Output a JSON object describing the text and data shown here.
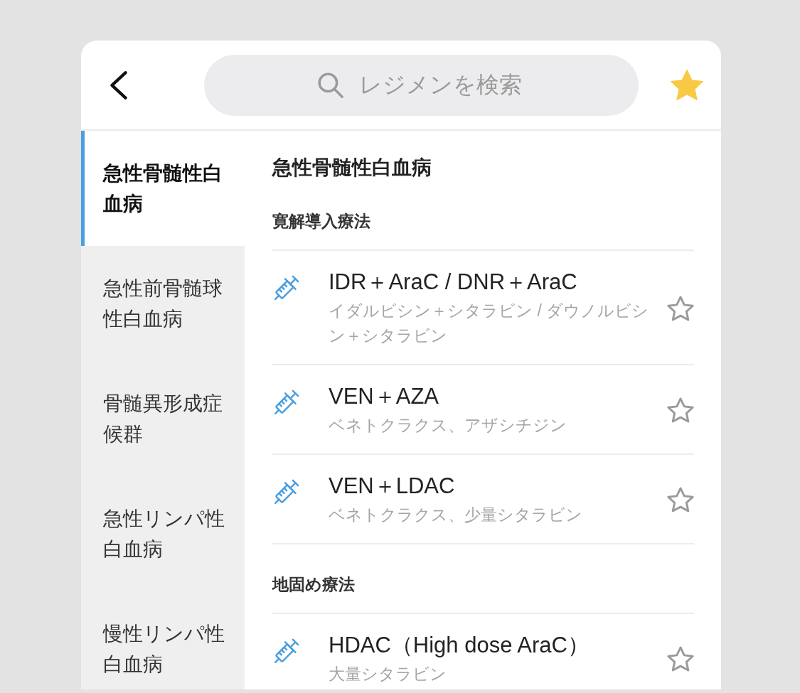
{
  "header": {
    "search": {
      "placeholder": "レジメンを検索"
    }
  },
  "sidebar": {
    "items": [
      {
        "label": "急性骨髄性白血病",
        "selected": true
      },
      {
        "label": "急性前骨髄球性白血病",
        "selected": false
      },
      {
        "label": "骨髄異形成症候群",
        "selected": false
      },
      {
        "label": "急性リンパ性白血病",
        "selected": false
      },
      {
        "label": "慢性リンパ性白血病",
        "selected": false
      }
    ]
  },
  "content": {
    "title": "急性骨髄性白血病",
    "sections": [
      {
        "heading": "寛解導入療法",
        "regimens": [
          {
            "name": "IDR＋AraC / DNR＋AraC",
            "drugs": "イダルビシン＋シタラビン / ダウノルビシン＋シタラビン",
            "favorite": false
          },
          {
            "name": "VEN＋AZA",
            "drugs": "ベネトクラクス、アザシチジン",
            "favorite": false
          },
          {
            "name": "VEN＋LDAC",
            "drugs": "ベネトクラクス、少量シタラビン",
            "favorite": false
          }
        ]
      },
      {
        "heading": "地固め療法",
        "regimens": [
          {
            "name": "HDAC（High dose AraC）",
            "drugs": "大量シタラビン",
            "favorite": false
          }
        ]
      }
    ]
  }
}
